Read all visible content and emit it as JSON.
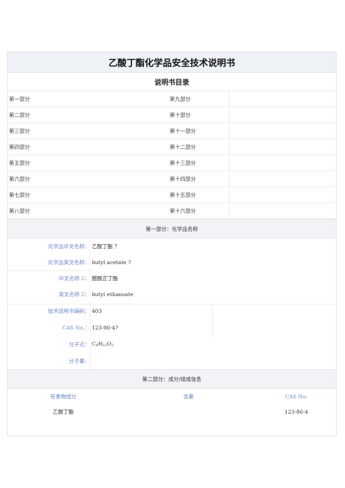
{
  "title": "乙酸丁酯化学品安全技术说明书",
  "toc": {
    "heading": "说明书目录",
    "rows": [
      {
        "left": "第一部分",
        "right": "第九部分"
      },
      {
        "left": "第二部分",
        "right": "第十部分"
      },
      {
        "left": "第三部分",
        "right": "第十一部分"
      },
      {
        "left": "第四部分",
        "right": "第十二部分"
      },
      {
        "left": "第五部分",
        "right": "第十三部分"
      },
      {
        "left": "第六部分",
        "right": "第十四部分"
      },
      {
        "left": "第七部分",
        "right": "第十五部分"
      },
      {
        "left": "第八部分",
        "right": "第十六部分"
      }
    ]
  },
  "section1": {
    "heading": "第一部分：化学品名称",
    "rows": [
      {
        "label": "化学品中文名称：",
        "value": "乙酸丁酯 ？"
      },
      {
        "label": "化学品英文名称：",
        "value": "butyl acetate ?"
      },
      {
        "label": "中文名称 2：",
        "value": "醋酸正丁酯"
      },
      {
        "label": "英文名称 2：",
        "value": "butyl ethanoate"
      },
      {
        "label": "技术说明书编码：",
        "value": "403"
      },
      {
        "label": "CAS No.：",
        "value": "123-86-4?"
      },
      {
        "label": "分子式：",
        "value_parts": [
          "C",
          "6",
          "H",
          "12",
          "O",
          "2"
        ]
      },
      {
        "label": "分子量：",
        "value": ""
      }
    ]
  },
  "section2": {
    "heading": "第二部分：成分/组成信息",
    "columns": [
      "有害物成分",
      "含量",
      "CAS No."
    ],
    "rows": [
      {
        "name": "乙酸丁酯",
        "content": "",
        "cas": "123-86-4"
      }
    ]
  }
}
